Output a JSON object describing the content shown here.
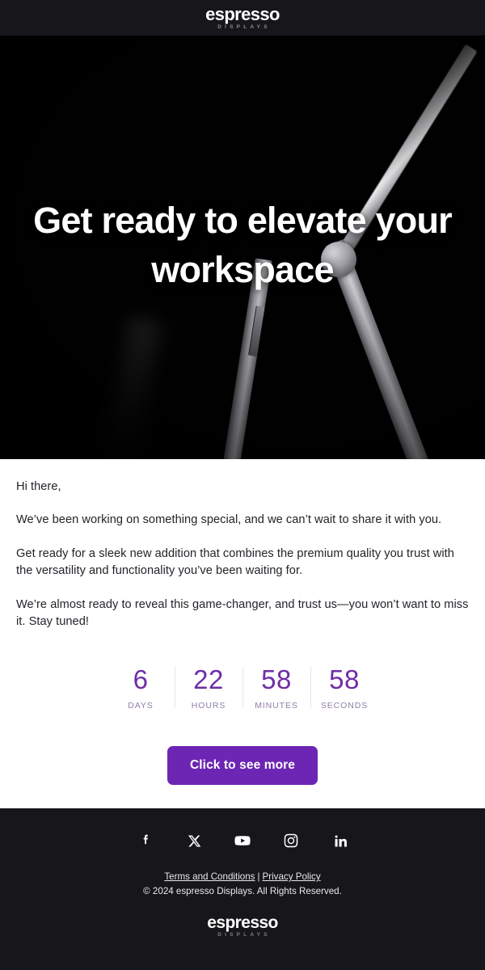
{
  "header": {
    "logo_word": "espresso",
    "logo_sub": "DISPLAYS"
  },
  "hero": {
    "headline": "Get ready to elevate your workspace",
    "image_description": "close-up of a dark metallic monitor stand arm with pivot joint on black background"
  },
  "body": {
    "greeting": "Hi there,",
    "paragraph_1": "We’ve been working on something special, and we can’t wait to share it with you.",
    "paragraph_2": "Get ready for a sleek new addition that combines the premium quality you trust with the versatility and functionality you’ve been waiting for.",
    "paragraph_3": "We’re almost ready to reveal this game-changer, and trust us—you won’t want to miss it. Stay tuned!"
  },
  "countdown": {
    "units": [
      {
        "value": "6",
        "label": "DAYS"
      },
      {
        "value": "22",
        "label": "HOURS"
      },
      {
        "value": "58",
        "label": "MINUTES"
      },
      {
        "value": "58",
        "label": "SECONDS"
      }
    ],
    "value_color": "#6f2da8",
    "label_color": "#8f7fa5"
  },
  "cta": {
    "label": "Click to see more",
    "background_color": "#6c26b3",
    "text_color": "#ffffff"
  },
  "footer": {
    "social": [
      {
        "name": "facebook-icon",
        "label": "Facebook"
      },
      {
        "name": "x-twitter-icon",
        "label": "X"
      },
      {
        "name": "youtube-icon",
        "label": "YouTube"
      },
      {
        "name": "instagram-icon",
        "label": "Instagram"
      },
      {
        "name": "linkedin-icon",
        "label": "LinkedIn"
      }
    ],
    "terms_label": "Terms and Conditions",
    "separator": "|",
    "privacy_label": "Privacy Policy",
    "copyright": "© 2024 espresso Displays. All Rights Reserved.",
    "logo_word": "espresso",
    "logo_sub": "DISPLAYS"
  },
  "colors": {
    "header_bg": "#17171b",
    "hero_bg": "#000000",
    "body_bg": "#ffffff",
    "footer_bg": "#17171b",
    "accent_purple": "#6c26b3"
  }
}
